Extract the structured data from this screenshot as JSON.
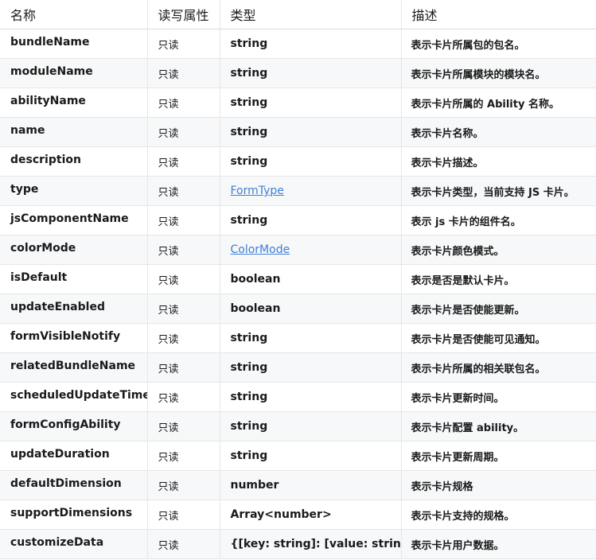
{
  "headers": [
    "名称",
    "读写属性",
    "类型",
    "描述"
  ],
  "rows": [
    {
      "name": "bundleName",
      "rw": "只读",
      "type": "string",
      "link": false,
      "desc": "表示卡片所属包的包名。"
    },
    {
      "name": "moduleName",
      "rw": "只读",
      "type": "string",
      "link": false,
      "desc": "表示卡片所属模块的模块名。"
    },
    {
      "name": "abilityName",
      "rw": "只读",
      "type": "string",
      "link": false,
      "desc": "表示卡片所属的 Ability 名称。"
    },
    {
      "name": "name",
      "rw": "只读",
      "type": "string",
      "link": false,
      "desc": "表示卡片名称。"
    },
    {
      "name": "description",
      "rw": "只读",
      "type": "string",
      "link": false,
      "desc": "表示卡片描述。"
    },
    {
      "name": "type",
      "rw": "只读",
      "type": "FormType",
      "link": true,
      "desc": "表示卡片类型，当前支持 JS 卡片。"
    },
    {
      "name": "jsComponentName",
      "rw": "只读",
      "type": "string",
      "link": false,
      "desc": "表示 js 卡片的组件名。"
    },
    {
      "name": "colorMode",
      "rw": "只读",
      "type": "ColorMode",
      "link": true,
      "desc": "表示卡片颜色模式。"
    },
    {
      "name": "isDefault",
      "rw": "只读",
      "type": "boolean",
      "link": false,
      "desc": "表示是否是默认卡片。"
    },
    {
      "name": "updateEnabled",
      "rw": "只读",
      "type": "boolean",
      "link": false,
      "desc": "表示卡片是否使能更新。"
    },
    {
      "name": "formVisibleNotify",
      "rw": "只读",
      "type": "string",
      "link": false,
      "desc": "表示卡片是否使能可见通知。"
    },
    {
      "name": "relatedBundleName",
      "rw": "只读",
      "type": "string",
      "link": false,
      "desc": "表示卡片所属的相关联包名。"
    },
    {
      "name": "scheduledUpdateTime",
      "rw": "只读",
      "type": "string",
      "link": false,
      "desc": "表示卡片更新时间。"
    },
    {
      "name": "formConfigAbility",
      "rw": "只读",
      "type": "string",
      "link": false,
      "desc": "表示卡片配置 ability。"
    },
    {
      "name": "updateDuration",
      "rw": "只读",
      "type": "string",
      "link": false,
      "desc": "表示卡片更新周期。"
    },
    {
      "name": "defaultDimension",
      "rw": "只读",
      "type": "number",
      "link": false,
      "desc": "表示卡片规格"
    },
    {
      "name": "supportDimensions",
      "rw": "只读",
      "type": "Array<number>",
      "link": false,
      "desc": "表示卡片支持的规格。"
    },
    {
      "name": "customizeData",
      "rw": "只读",
      "type": "{[key: string]: [value: string]}",
      "link": false,
      "desc": "表示卡片用户数据。"
    }
  ],
  "colors": {
    "link": "#3f7fd6",
    "border": "#e6e6e6",
    "stripe": "#f7f8f9"
  }
}
